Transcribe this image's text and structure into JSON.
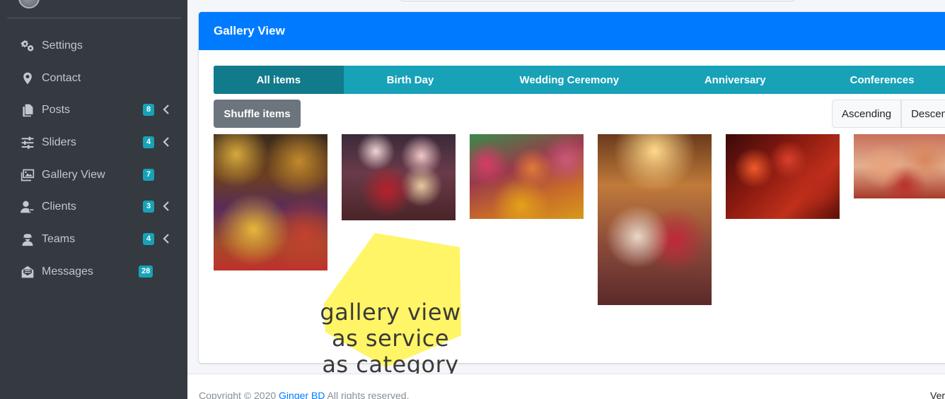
{
  "sidebar": {
    "items": [
      {
        "label": "Settings",
        "icon": "cogs-icon",
        "badge": null,
        "has_chevron": false
      },
      {
        "label": "Contact",
        "icon": "map-marker-icon",
        "badge": null,
        "has_chevron": false
      },
      {
        "label": "Posts",
        "icon": "copy-icon",
        "badge": "8",
        "has_chevron": true
      },
      {
        "label": "Sliders",
        "icon": "sliders-icon",
        "badge": "4",
        "has_chevron": true
      },
      {
        "label": "Gallery View",
        "icon": "images-icon",
        "badge": "7",
        "has_chevron": false
      },
      {
        "label": "Clients",
        "icon": "user-tie-icon",
        "badge": "3",
        "has_chevron": true
      },
      {
        "label": "Teams",
        "icon": "user-secret-icon",
        "badge": "4",
        "has_chevron": true
      },
      {
        "label": "Messages",
        "icon": "envelope-open-icon",
        "badge": "28",
        "has_chevron": false
      }
    ]
  },
  "card": {
    "title": "Gallery View",
    "filters": [
      "All items",
      "Birth Day",
      "Wedding Ceremony",
      "Anniversary",
      "Conferences"
    ],
    "active_filter": "All items",
    "shuffle_label": "Shuffle items",
    "sort": [
      "Ascending",
      "Descending"
    ]
  },
  "gallery": {
    "items": [
      {
        "name": "gallery-image-decor-collage"
      },
      {
        "name": "gallery-image-wedding-couple"
      },
      {
        "name": "gallery-image-holi-celebration"
      },
      {
        "name": "gallery-image-couple-portrait"
      },
      {
        "name": "gallery-image-red-lanterns"
      },
      {
        "name": "gallery-image-henna-hands"
      }
    ]
  },
  "footer": {
    "copyright": "Copyright © 2020 ",
    "brand": "Ginger BD",
    "rights": " All rights reserved.",
    "version": "Version"
  },
  "annotation": {
    "line1": "gallery view",
    "line2": "as service",
    "line3": "as category",
    "color": "#fff566"
  },
  "colors": {
    "sidebar_bg": "#343a40",
    "header_blue": "#007bff",
    "filter_teal": "#17a2b8",
    "filter_active": "#117a8b",
    "badge": "#17a2b8"
  }
}
